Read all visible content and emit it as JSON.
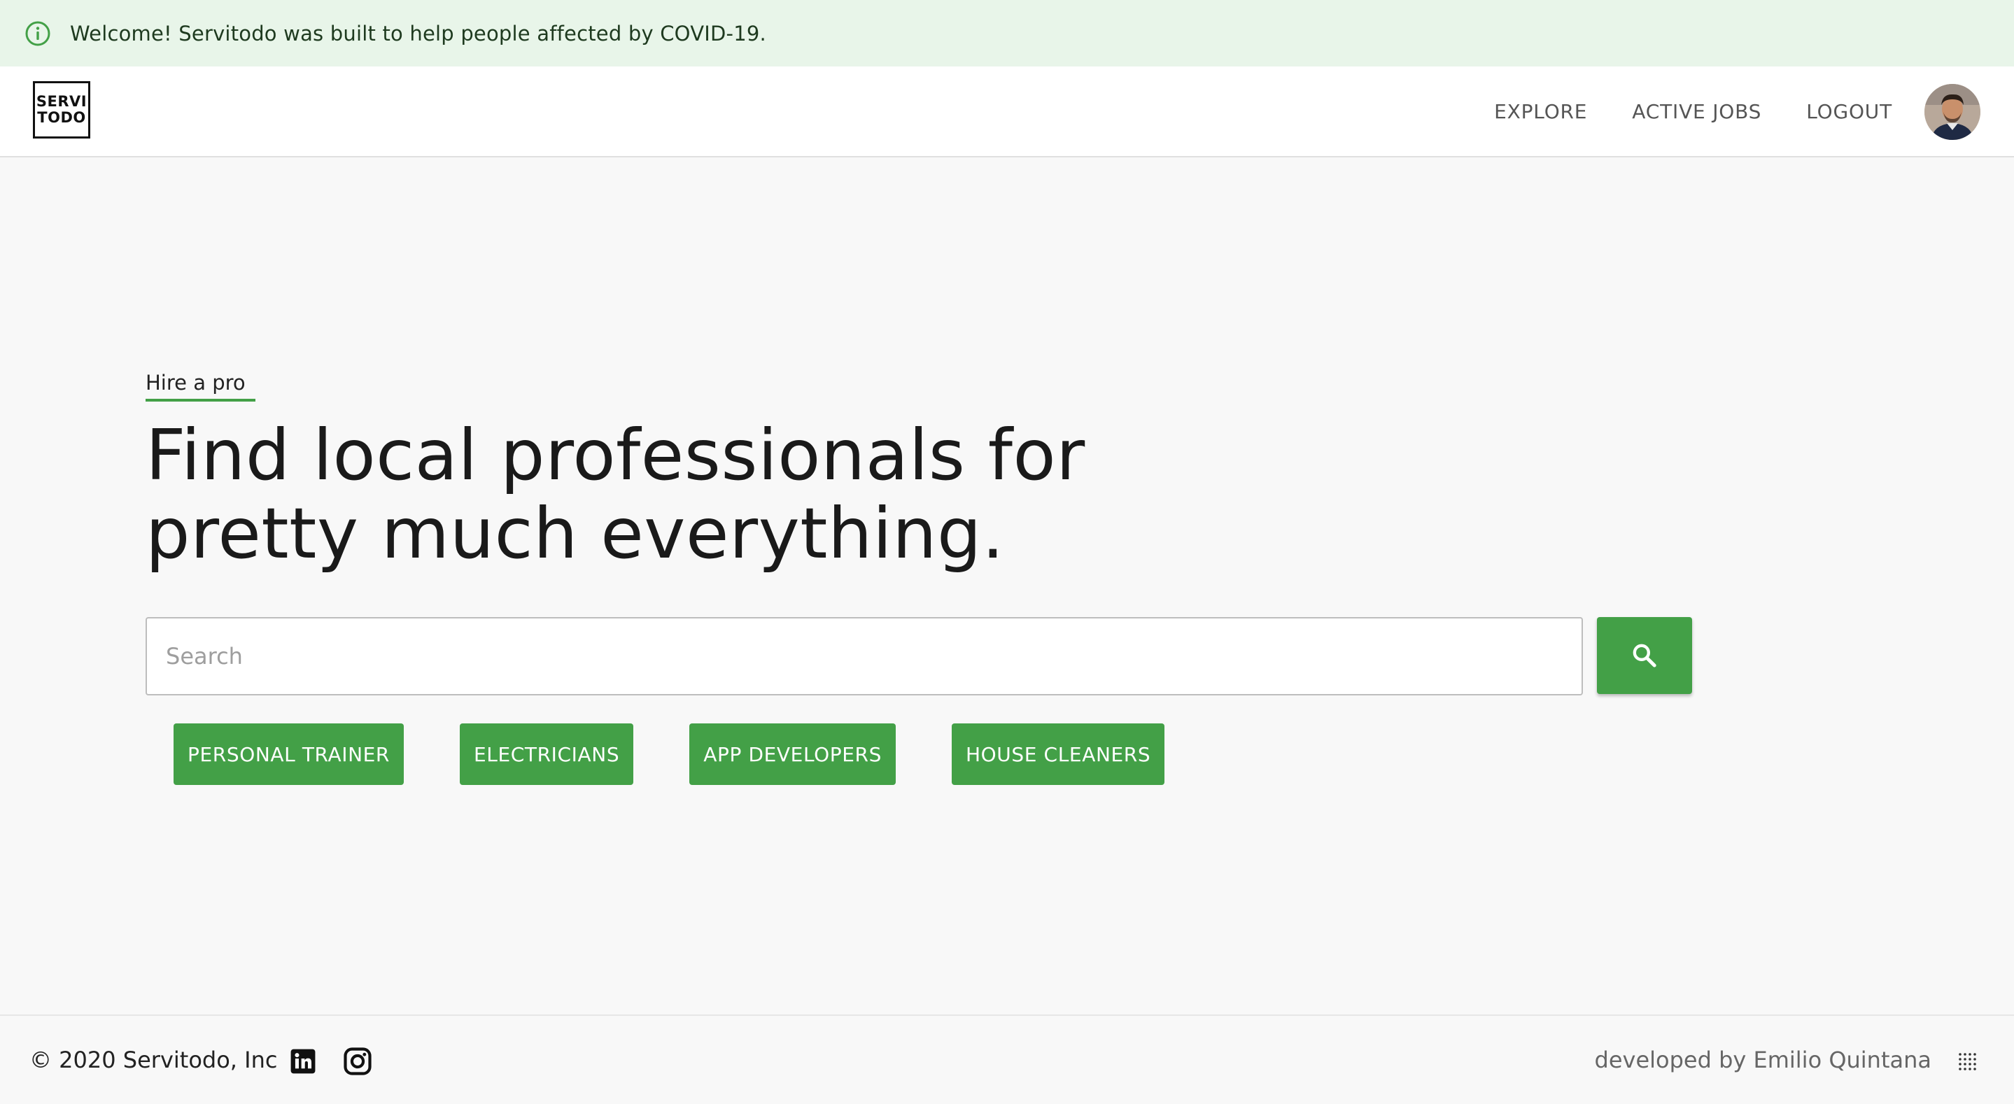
{
  "banner": {
    "message": "Welcome! Servitodo was built to help people affected by COVID-19.",
    "icon": "info-icon"
  },
  "header": {
    "logo_line1": "SERVI",
    "logo_line2": "TODO",
    "nav": [
      {
        "label": "EXPLORE"
      },
      {
        "label": "ACTIVE JOBS"
      },
      {
        "label": "LOGOUT"
      }
    ],
    "avatar_icon": "user-avatar"
  },
  "hero": {
    "tag": "Hire a pro",
    "headline_line1": "Find local professionals for",
    "headline_line2": "pretty much everything.",
    "search_placeholder": "Search",
    "search_value": "",
    "search_button_icon": "search-icon",
    "chips": [
      {
        "label": "PERSONAL TRAINER"
      },
      {
        "label": "ELECTRICIANS"
      },
      {
        "label": "APP DEVELOPERS"
      },
      {
        "label": "HOUSE CLEANERS"
      }
    ]
  },
  "footer": {
    "copyright": "© 2020 Servitodo, Inc",
    "developer": "developed by Emilio Quintana",
    "social": [
      "linkedin-icon",
      "instagram-icon"
    ]
  },
  "colors": {
    "accent": "#43a047",
    "banner_bg": "#e8f5e9",
    "page_bg": "#f8f8f8"
  }
}
